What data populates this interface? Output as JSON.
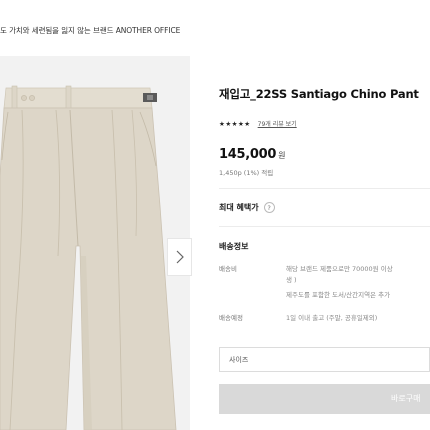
{
  "header": {
    "tagline": "도 가치와 세련됨을 잃지 않는 브랜드 ANOTHER OFFICE"
  },
  "gallery": {
    "next_icon": "chevron-right-icon"
  },
  "product": {
    "title": "재입고_22SS Santiago Chino Pant",
    "rating_stars": "★★★★★",
    "review_link": "79개 리뷰 보기",
    "price": "145,000",
    "price_unit": "원",
    "points": "1,450p (1%) 적립"
  },
  "benefit": {
    "label": "최대 혜택가",
    "help_glyph": "?"
  },
  "shipping": {
    "title": "배송정보",
    "rows": [
      {
        "label": "배송비",
        "lines": [
          "해당 브랜드 제품으로만 70000원 이상",
          "생 )",
          "제주도를 포함한 도서/산간지역은 추가"
        ]
      },
      {
        "label": "배송예정",
        "lines": [
          "1일 이내 출고 (주말, 공휴일제외)"
        ]
      }
    ]
  },
  "size_select": {
    "label": "사이즈"
  },
  "buy_button": {
    "label": "바로구매"
  },
  "colors": {
    "gallery_bg": "#f2f2f2",
    "pants": "#ddd6c8",
    "button": "#d9d9d9"
  }
}
